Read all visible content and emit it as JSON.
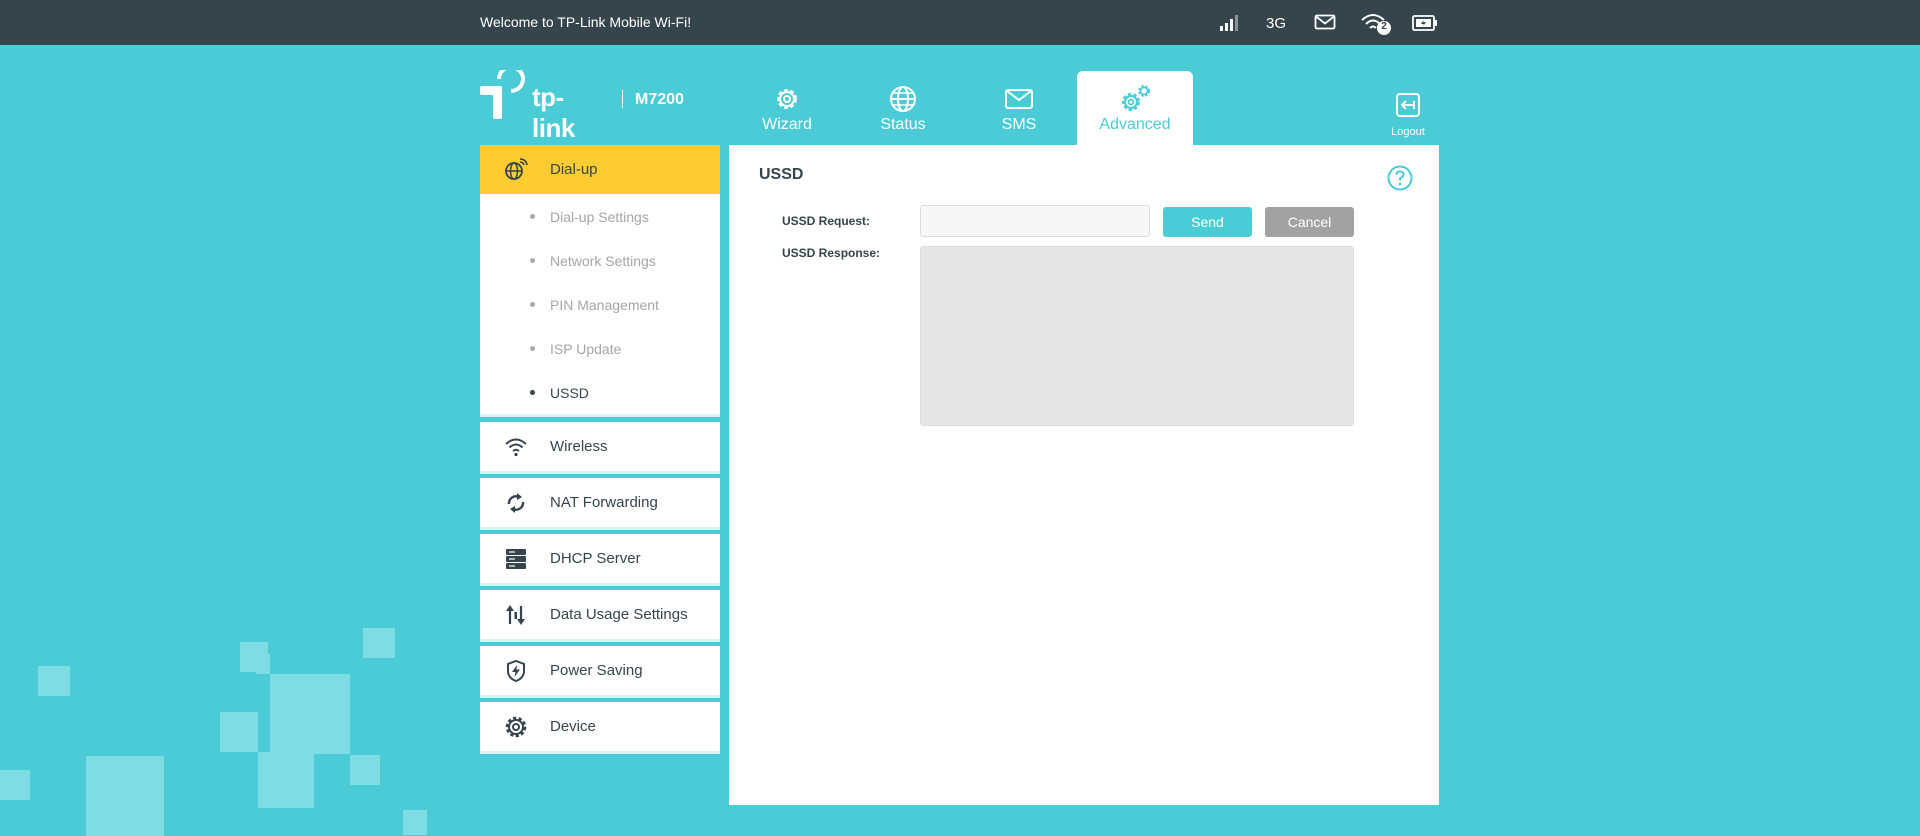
{
  "topbar": {
    "welcome": "Welcome to TP-Link Mobile Wi-Fi!",
    "network_type": "3G",
    "wifi_clients": "2",
    "icons": [
      "signal-bars-icon",
      "mail-icon",
      "wifi-icon",
      "battery-icon"
    ]
  },
  "logo": {
    "brand": "tp-link",
    "model": "M7200"
  },
  "nav": {
    "items": [
      {
        "label": "Wizard",
        "icon": "gear-icon"
      },
      {
        "label": "Status",
        "icon": "globe-icon"
      },
      {
        "label": "SMS",
        "icon": "envelope-icon"
      },
      {
        "label": "Advanced",
        "icon": "gears-icon"
      }
    ],
    "active": "Advanced",
    "logout": "Logout"
  },
  "sidebar": {
    "groups": [
      {
        "label": "Dial-up",
        "icon": "globe-signal-icon",
        "sub": [
          "Dial-up Settings",
          "Network Settings",
          "PIN Management",
          "ISP Update",
          "USSD"
        ],
        "current_sub": "USSD"
      },
      {
        "label": "Wireless",
        "icon": "wifi-icon"
      },
      {
        "label": "NAT Forwarding",
        "icon": "refresh-icon"
      },
      {
        "label": "DHCP Server",
        "icon": "server-icon"
      },
      {
        "label": "Data Usage Settings",
        "icon": "up-down-arrows-icon"
      },
      {
        "label": "Power Saving",
        "icon": "shield-bolt-icon"
      },
      {
        "label": "Device",
        "icon": "gear-icon"
      }
    ],
    "active": "Dial-up"
  },
  "content": {
    "title": "USSD",
    "request_label": "USSD Request:",
    "response_label": "USSD Response:",
    "request_value": "",
    "response_value": "",
    "send": "Send",
    "cancel": "Cancel"
  },
  "colors": {
    "background": "#4acbd6",
    "topbar": "#36444c",
    "active_menu": "#fdcc33",
    "send_button": "#4acbd6",
    "cancel_button": "#a2a2a2"
  }
}
